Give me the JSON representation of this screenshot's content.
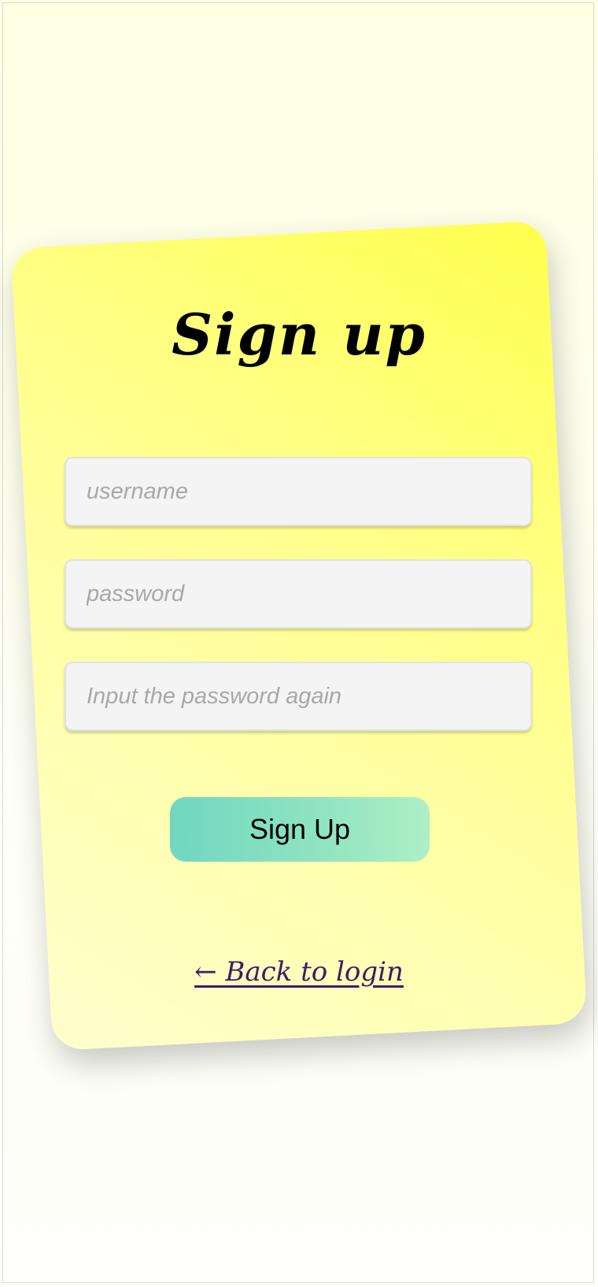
{
  "colors": {
    "background": "#ffffe3",
    "card_gradient_start": "#ffff4d",
    "card_gradient_end": "#fffecd",
    "input_background": "#f4f4f4",
    "placeholder_text": "#a8a8a8",
    "button_gradient_start": "#6fd7c1",
    "button_gradient_end": "#aeefc6",
    "link_color": "#3b1c6b"
  },
  "signup_form": {
    "title": "Sign up",
    "username_field": {
      "value": "",
      "placeholder": "username"
    },
    "password_field": {
      "value": "",
      "placeholder": "password"
    },
    "confirm_password_field": {
      "value": "",
      "placeholder": "Input the password again"
    },
    "submit_label": "Sign Up",
    "back_link": {
      "arrow_icon": "left-arrow-icon",
      "label": "← Back to login"
    }
  }
}
